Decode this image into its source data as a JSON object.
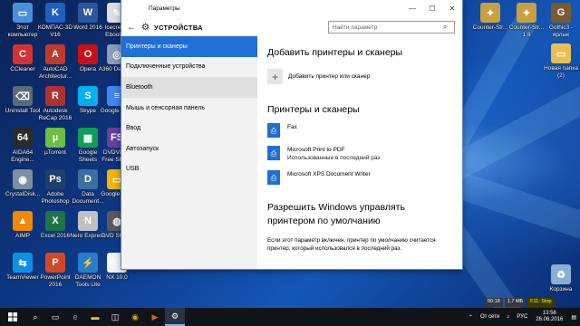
{
  "desktop": {
    "icons": [
      {
        "label": "Этот компьютер",
        "icon": "computer-icon",
        "color": "#4a90d9",
        "glyph": "▭"
      },
      {
        "label": "КОМПАС-3D V16",
        "icon": "kompas-icon",
        "color": "#1f5fbf",
        "glyph": "K"
      },
      {
        "label": "Word 2016",
        "icon": "word-icon",
        "color": "#2b579a",
        "glyph": "W"
      },
      {
        "label": "Iceсream Ebook ...",
        "icon": "icecream-ebook-icon",
        "color": "#e0e0e0",
        "glyph": "✎"
      },
      {
        "label": "CCleaner",
        "icon": "ccleaner-icon",
        "color": "#d83030",
        "glyph": "C"
      },
      {
        "label": "AutoCAD Architectur...",
        "icon": "autocad-icon",
        "color": "#c0392b",
        "glyph": "A"
      },
      {
        "label": "Opera",
        "icon": "opera-icon",
        "color": "#cc0f16",
        "glyph": "O"
      },
      {
        "label": "A360 Desktop",
        "icon": "a360-icon",
        "color": "#8aa0b8",
        "glyph": "◎"
      },
      {
        "label": "Uninstall Tool",
        "icon": "uninstall-tool-icon",
        "color": "#5a6a7a",
        "glyph": "⌫"
      },
      {
        "label": "Autodesk ReCap 2016",
        "icon": "recap-icon",
        "color": "#b03030",
        "glyph": "R"
      },
      {
        "label": "Skype",
        "icon": "skype-icon",
        "color": "#00aff0",
        "glyph": "S"
      },
      {
        "label": "Google Do...",
        "icon": "google-docs-icon",
        "color": "#4285f4",
        "glyph": "≡"
      },
      {
        "label": "AIDA64 Engine...",
        "icon": "aida64-icon",
        "color": "#2a2a2a",
        "glyph": "64"
      },
      {
        "label": "µTorrent",
        "icon": "utorrent-icon",
        "color": "#6dbe45",
        "glyph": "µ"
      },
      {
        "label": "Google Sheets",
        "icon": "google-sheets-icon",
        "color": "#0f9d58",
        "glyph": "▦"
      },
      {
        "label": "DVDVideo Free Studio",
        "icon": "dvdvideo-icon",
        "color": "#6a3fa0",
        "glyph": "FS"
      },
      {
        "label": "CrystalDisk...",
        "icon": "crystaldisk-icon",
        "color": "#7a8fa0",
        "glyph": "◉"
      },
      {
        "label": "Adobe Photoshop",
        "icon": "photoshop-icon",
        "color": "#1c3f6e",
        "glyph": "Ps"
      },
      {
        "label": "Data Document...",
        "icon": "data-document-icon",
        "color": "#3c6ea0",
        "glyph": "D"
      },
      {
        "label": "Google Sli...",
        "icon": "google-slides-icon",
        "color": "#f4b400",
        "glyph": "▭"
      },
      {
        "label": "AIMP",
        "icon": "aimp-icon",
        "color": "#f08a00",
        "glyph": "▲"
      },
      {
        "label": "Excel 2016",
        "icon": "excel-icon",
        "color": "#217346",
        "glyph": "X"
      },
      {
        "label": "Nero Express",
        "icon": "nero-icon",
        "color": "#c0c0c0",
        "glyph": "N"
      },
      {
        "label": "DVD Studio",
        "icon": "dvd-studio-icon",
        "color": "#5a5a5a",
        "glyph": "◍"
      },
      {
        "label": "TeamViewer",
        "icon": "teamviewer-icon",
        "color": "#0e8ee9",
        "glyph": "⇆"
      },
      {
        "label": "PowerPoint 2016",
        "icon": "powerpoint-icon",
        "color": "#d24726",
        "glyph": "P"
      },
      {
        "label": "DAEMON Tools Lite",
        "icon": "daemon-tools-icon",
        "color": "#2a7ad0",
        "glyph": "⚡"
      },
      {
        "label": "NX 10.0",
        "icon": "nx-icon",
        "color": "#f5f5f5",
        "glyph": "NX"
      }
    ],
    "right_icons": [
      {
        "label": "Counter-Str...",
        "icon": "counter-strike-icon",
        "color": "#c8a040",
        "glyph": "✦"
      },
      {
        "label": "Counter-Str... 1.6",
        "icon": "counter-strike-16-icon",
        "color": "#c8a040",
        "glyph": "✦"
      },
      {
        "label": "Gothic3 - ярлык",
        "icon": "gothic3-icon",
        "color": "#7a5a30",
        "glyph": "G"
      },
      {
        "label": "Новая папка (2)",
        "icon": "new-folder-icon",
        "color": "#e8c050",
        "glyph": "▭"
      },
      {
        "label": "Корзина",
        "icon": "recycle-bin-icon",
        "color": "#8ab0d0",
        "glyph": "♻"
      }
    ]
  },
  "window": {
    "title": "Параметры",
    "section": "УСТРОЙСТВА",
    "search_placeholder": "Найти параметр",
    "nav": [
      "Принтеры и сканеры",
      "Подключенные устройства",
      "Bluetooth",
      "Мышь и сенсорная панель",
      "Ввод",
      "Автозапуск",
      "USB"
    ],
    "add_heading": "Добавить принтеры и сканеры",
    "add_label": "Добавить принтер или сканер",
    "printers_heading": "Принтеры и сканеры",
    "printers": [
      {
        "name": "Fax",
        "sub": ""
      },
      {
        "name": "Microsoft Print to PDF",
        "sub": "Использованные в последний раз"
      },
      {
        "name": "Microsoft XPS Document Writer",
        "sub": ""
      }
    ],
    "default_heading": "Разрешить Windows управлять принтером по умолчанию",
    "default_text": "Если этот параметр включен, принтер по умолчанию считается принтер, который использовался в последний раз."
  },
  "overlay": {
    "time": "00:18",
    "size": "1.7 МБ",
    "fps_label": "F11: Stop"
  },
  "taskbar": {
    "tray_net": "От сети",
    "lang": "РУС",
    "time": "13:56",
    "date": "26.06.2016"
  },
  "colors": {
    "accent": "#1f6fd6",
    "taskbar": "#101418"
  }
}
